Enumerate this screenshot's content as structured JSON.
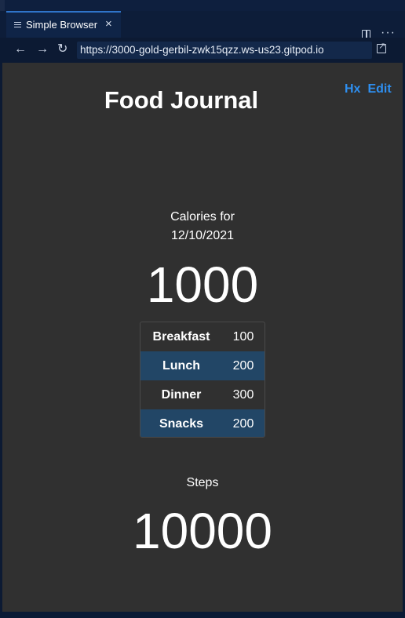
{
  "browser": {
    "tab_title": "Simple Browser",
    "tab_close": "×",
    "url": "https://3000-gold-gerbil-zwk15qzz.ws-us23.gitpod.io",
    "back": "←",
    "forward": "→",
    "reload": "↻",
    "more": "···"
  },
  "page": {
    "title": "Food Journal",
    "links": [
      "Hx",
      "Edit"
    ],
    "calories_label": "Calories for",
    "date": "12/10/2021",
    "calories_total": "1000",
    "meals": [
      {
        "name": "Breakfast",
        "calories": "100"
      },
      {
        "name": "Lunch",
        "calories": "200"
      },
      {
        "name": "Dinner",
        "calories": "300"
      },
      {
        "name": "Snacks",
        "calories": "200"
      }
    ],
    "steps_label": "Steps",
    "steps_total": "10000"
  },
  "colors": {
    "page_background": "#303030",
    "link": "#2e8ff0",
    "alt_row": "#224666",
    "chrome": "#0c1a33"
  },
  "icons": {
    "tab": "menu-lines-icon",
    "split": "split-editor-icon",
    "more": "more-actions-icon",
    "external": "open-external-icon"
  }
}
